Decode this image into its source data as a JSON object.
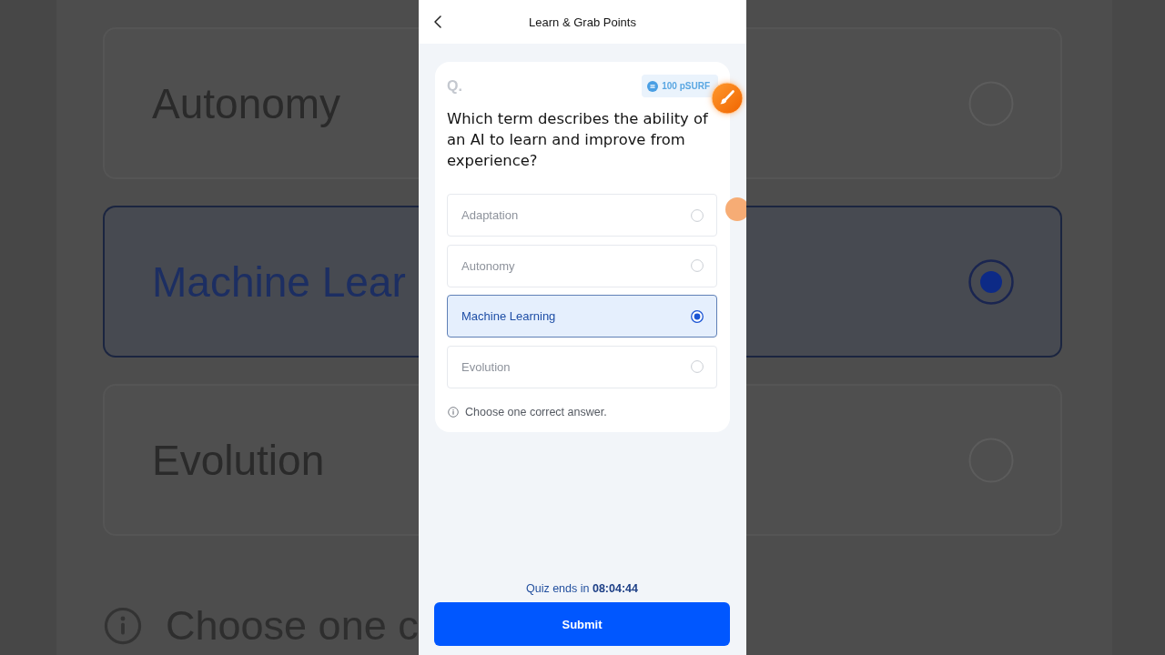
{
  "backdrop": {
    "options": [
      {
        "label": "Autonomy",
        "selected": false
      },
      {
        "label": "Machine Lear",
        "selected": true
      },
      {
        "label": "Evolution",
        "selected": false
      }
    ],
    "hint": "Choose one c"
  },
  "header": {
    "title": "Learn & Grab Points"
  },
  "question": {
    "prefix": "Q.",
    "reward": "100 pSURF",
    "text": "Which term describes the ability of an AI to learn and improve from experience?"
  },
  "options": [
    {
      "label": "Adaptation",
      "selected": false
    },
    {
      "label": "Autonomy",
      "selected": false
    },
    {
      "label": "Machine Learning",
      "selected": true
    },
    {
      "label": "Evolution",
      "selected": false
    }
  ],
  "hint": "Choose one correct answer.",
  "timer": "Quiz ends in **08:04:44**",
  "submit": "Submit"
}
